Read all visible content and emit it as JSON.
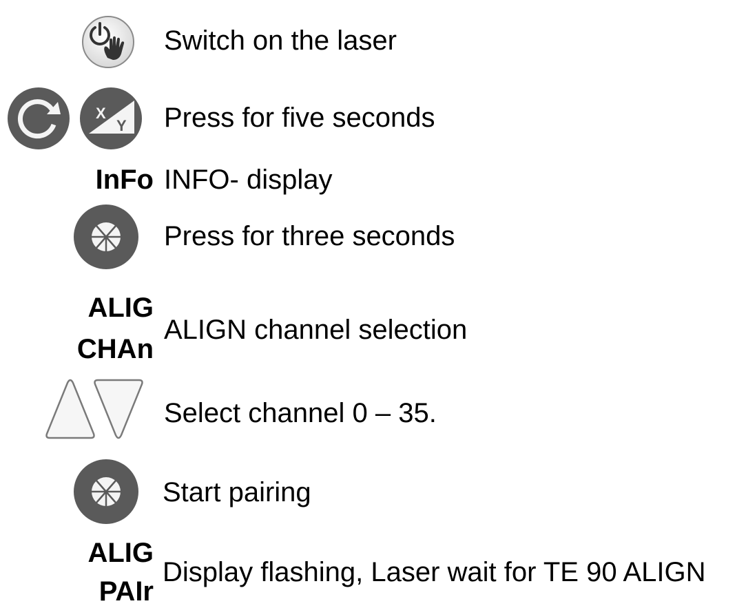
{
  "steps": [
    {
      "icon": "power-hand-button-icon",
      "text": "Switch on the laser"
    },
    {
      "icons": [
        "rotate-button-icon",
        "xy-slope-button-icon"
      ],
      "text": "Press for five seconds"
    },
    {
      "code": "InFo",
      "text": "INFO- display"
    },
    {
      "icon": "alignment-button-icon",
      "text": "Press for three seconds"
    },
    {
      "code": [
        "ALIG",
        "CHAn"
      ],
      "text": "ALIGN channel selection"
    },
    {
      "icons": [
        "arrow-up-button-icon",
        "arrow-down-button-icon"
      ],
      "text": "Select channel 0 – 35."
    },
    {
      "icon": "alignment-button-icon",
      "text": "Start pairing"
    },
    {
      "code": [
        "ALIG",
        "PAIr"
      ],
      "text": "Display flashing, Laser wait for TE 90 ALIGN"
    }
  ],
  "colors": {
    "button_dark": "#5a5a5a",
    "button_light": "#f0f0f0",
    "outline": "#7a7a7a"
  }
}
